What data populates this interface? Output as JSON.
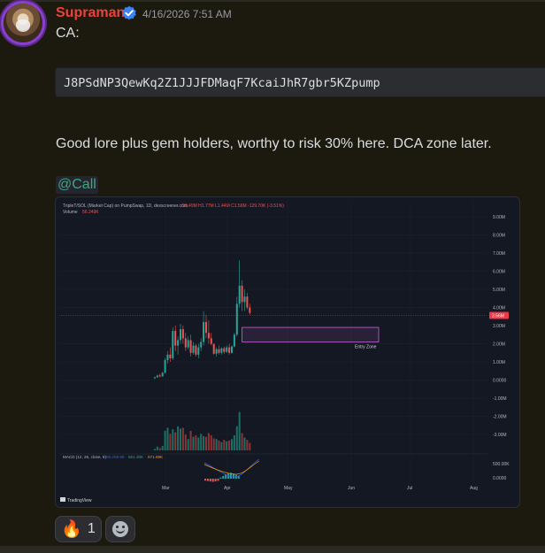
{
  "message": {
    "username": "Supraman",
    "timestamp": "4/16/2026 7:51 AM",
    "ca_label": "CA:",
    "contract_address": "J8PSdNP3QewKq2Z1JJJFDMaqF7KcaiJhR7gbr5KZpump",
    "text": "Good lore plus gem holders, worthy to risk 30% here. DCA zone later.",
    "mention": "@Call"
  },
  "reactions": [
    {
      "icon": "fire-icon",
      "emoji": "🔥",
      "count": "1"
    },
    {
      "icon": "add-reaction-icon"
    }
  ],
  "colors": {
    "username": "#e8443c",
    "mention_text": "#3ea87a",
    "verified_badge": "#3b82f6",
    "background": "#1c1a0f",
    "up_candle": "#26a69a",
    "down_candle": "#ef5350",
    "entry_zone": "#c862d6",
    "price_label": "#f23645"
  },
  "chart_data": {
    "type": "candlestick",
    "header": "TripleT/SOL (Market Cap) on PumpSwap, 1D, dexscreener.com",
    "header_values": "O1.49M H1.77M L1.44M C1.56M -129.70K (-3.51%)",
    "volume_label": "Volume",
    "volume_value": "56.249K",
    "price_tag": "3.56M",
    "y_ticks": [
      "9.00M",
      "8.00M",
      "7.00M",
      "6.00M",
      "5.00M",
      "4.00M",
      "3.00M",
      "2.00M",
      "1.00M",
      "0.0000",
      "-1.00M",
      "-2.00M",
      "-3.00M"
    ],
    "x_ticks": [
      "Mar",
      "Apr",
      "May",
      "Jun",
      "Jul",
      "Aug"
    ],
    "annotation": "Entry Zone",
    "entry_zone_range": [
      2.1,
      2.9
    ],
    "macd_label": "MACD (12, 26, close, 9)",
    "macd_values": [
      "89,208.99",
      "661.30K",
      "571.89K"
    ],
    "macd_ticks": [
      "500.00K",
      "0.0000"
    ],
    "branding": "TradingView",
    "candles": [
      {
        "o": 0.1,
        "h": 0.18,
        "l": 0.05,
        "c": 0.15
      },
      {
        "o": 0.15,
        "h": 0.3,
        "l": 0.12,
        "c": 0.25
      },
      {
        "o": 0.25,
        "h": 0.35,
        "l": 0.15,
        "c": 0.2
      },
      {
        "o": 0.2,
        "h": 0.45,
        "l": 0.18,
        "c": 0.4
      },
      {
        "o": 0.4,
        "h": 1.2,
        "l": 0.35,
        "c": 1.1
      },
      {
        "o": 1.1,
        "h": 1.6,
        "l": 0.9,
        "c": 1.4
      },
      {
        "o": 1.4,
        "h": 1.8,
        "l": 1.0,
        "c": 1.2
      },
      {
        "o": 1.2,
        "h": 2.9,
        "l": 1.1,
        "c": 2.7
      },
      {
        "o": 2.7,
        "h": 3.0,
        "l": 1.6,
        "c": 1.9
      },
      {
        "o": 1.9,
        "h": 2.4,
        "l": 1.4,
        "c": 2.2
      },
      {
        "o": 2.2,
        "h": 3.1,
        "l": 2.0,
        "c": 2.8
      },
      {
        "o": 2.8,
        "h": 3.0,
        "l": 2.0,
        "c": 2.3
      },
      {
        "o": 2.3,
        "h": 2.6,
        "l": 1.6,
        "c": 1.8
      },
      {
        "o": 1.8,
        "h": 2.4,
        "l": 1.7,
        "c": 2.2
      },
      {
        "o": 2.2,
        "h": 2.5,
        "l": 1.3,
        "c": 1.5
      },
      {
        "o": 1.5,
        "h": 2.1,
        "l": 1.4,
        "c": 1.9
      },
      {
        "o": 1.9,
        "h": 2.0,
        "l": 1.3,
        "c": 1.4
      },
      {
        "o": 1.4,
        "h": 2.0,
        "l": 1.2,
        "c": 1.8
      },
      {
        "o": 1.8,
        "h": 2.3,
        "l": 1.6,
        "c": 2.1
      },
      {
        "o": 2.1,
        "h": 3.8,
        "l": 1.9,
        "c": 3.2
      },
      {
        "o": 3.2,
        "h": 3.6,
        "l": 2.3,
        "c": 2.6
      },
      {
        "o": 2.6,
        "h": 3.3,
        "l": 2.0,
        "c": 2.3
      },
      {
        "o": 2.3,
        "h": 2.6,
        "l": 1.9,
        "c": 2.0
      },
      {
        "o": 2.0,
        "h": 1.95,
        "l": 1.4,
        "c": 1.45
      },
      {
        "o": 1.45,
        "h": 1.8,
        "l": 1.3,
        "c": 1.7
      },
      {
        "o": 1.7,
        "h": 1.9,
        "l": 1.4,
        "c": 1.5
      },
      {
        "o": 1.5,
        "h": 1.8,
        "l": 1.4,
        "c": 1.75
      },
      {
        "o": 1.75,
        "h": 1.85,
        "l": 1.45,
        "c": 1.55
      },
      {
        "o": 1.55,
        "h": 1.9,
        "l": 1.5,
        "c": 1.8
      },
      {
        "o": 1.8,
        "h": 2.0,
        "l": 1.4,
        "c": 1.5
      },
      {
        "o": 1.5,
        "h": 1.9,
        "l": 1.45,
        "c": 1.85
      },
      {
        "o": 1.85,
        "h": 2.6,
        "l": 1.8,
        "c": 2.5
      },
      {
        "o": 2.5,
        "h": 4.6,
        "l": 2.4,
        "c": 4.2
      },
      {
        "o": 4.2,
        "h": 6.6,
        "l": 4.0,
        "c": 5.2
      },
      {
        "o": 5.2,
        "h": 5.5,
        "l": 3.8,
        "c": 4.3
      },
      {
        "o": 4.3,
        "h": 5.0,
        "l": 3.8,
        "c": 4.6
      },
      {
        "o": 4.6,
        "h": 4.8,
        "l": 3.9,
        "c": 4.0
      },
      {
        "o": 4.0,
        "h": 4.2,
        "l": 3.6,
        "c": 3.7
      }
    ],
    "volumes": [
      0.2,
      0.5,
      0.3,
      0.6,
      2.6,
      3.0,
      2.2,
      2.8,
      2.4,
      3.2,
      2.9,
      3.0,
      2.1,
      1.5,
      2.6,
      1.8,
      2.0,
      1.7,
      2.2,
      1.9,
      1.8,
      2.3,
      2.0,
      1.6,
      1.5,
      1.3,
      1.1,
      1.4,
      1.2,
      1.3,
      1.5,
      2.0,
      3.2,
      5.1,
      2.3,
      1.7,
      1.4,
      1.0
    ]
  }
}
